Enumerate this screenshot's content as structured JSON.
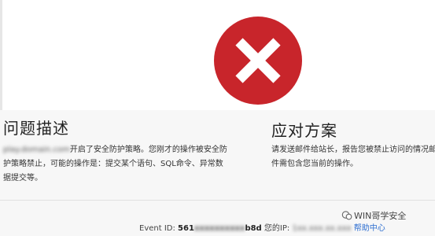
{
  "colors": {
    "error_red": "#c8252b",
    "link_blue": "#2f6fd0",
    "panel_bg": "#f7f7f7"
  },
  "icons": {
    "error": "error-x-icon",
    "watermark": "wechat-icon"
  },
  "left": {
    "title": "问题描述",
    "site_blurred": "play.domain.com",
    "desc_text": "开启了安全防护策略。您刚才的操作被安全防护策略禁止，可能的操作是：提交某个语句、SQL命令、异常数据提交等。"
  },
  "right": {
    "title": "应对方案",
    "desc_text": "请发送邮件给站长，报告您被禁止访问的情况邮件需包含您当前的操作。"
  },
  "footer": {
    "event_label": "Event ID:",
    "event_prefix": "561",
    "event_blurred": "xxxxxxxxxx",
    "event_suffix": "b8d",
    "ip_label": "您的IP:",
    "ip_blurred": "1xx.xxx.xx.xxx",
    "help_link": "帮助中心"
  },
  "watermark": {
    "text": "WIN哥学安全"
  }
}
